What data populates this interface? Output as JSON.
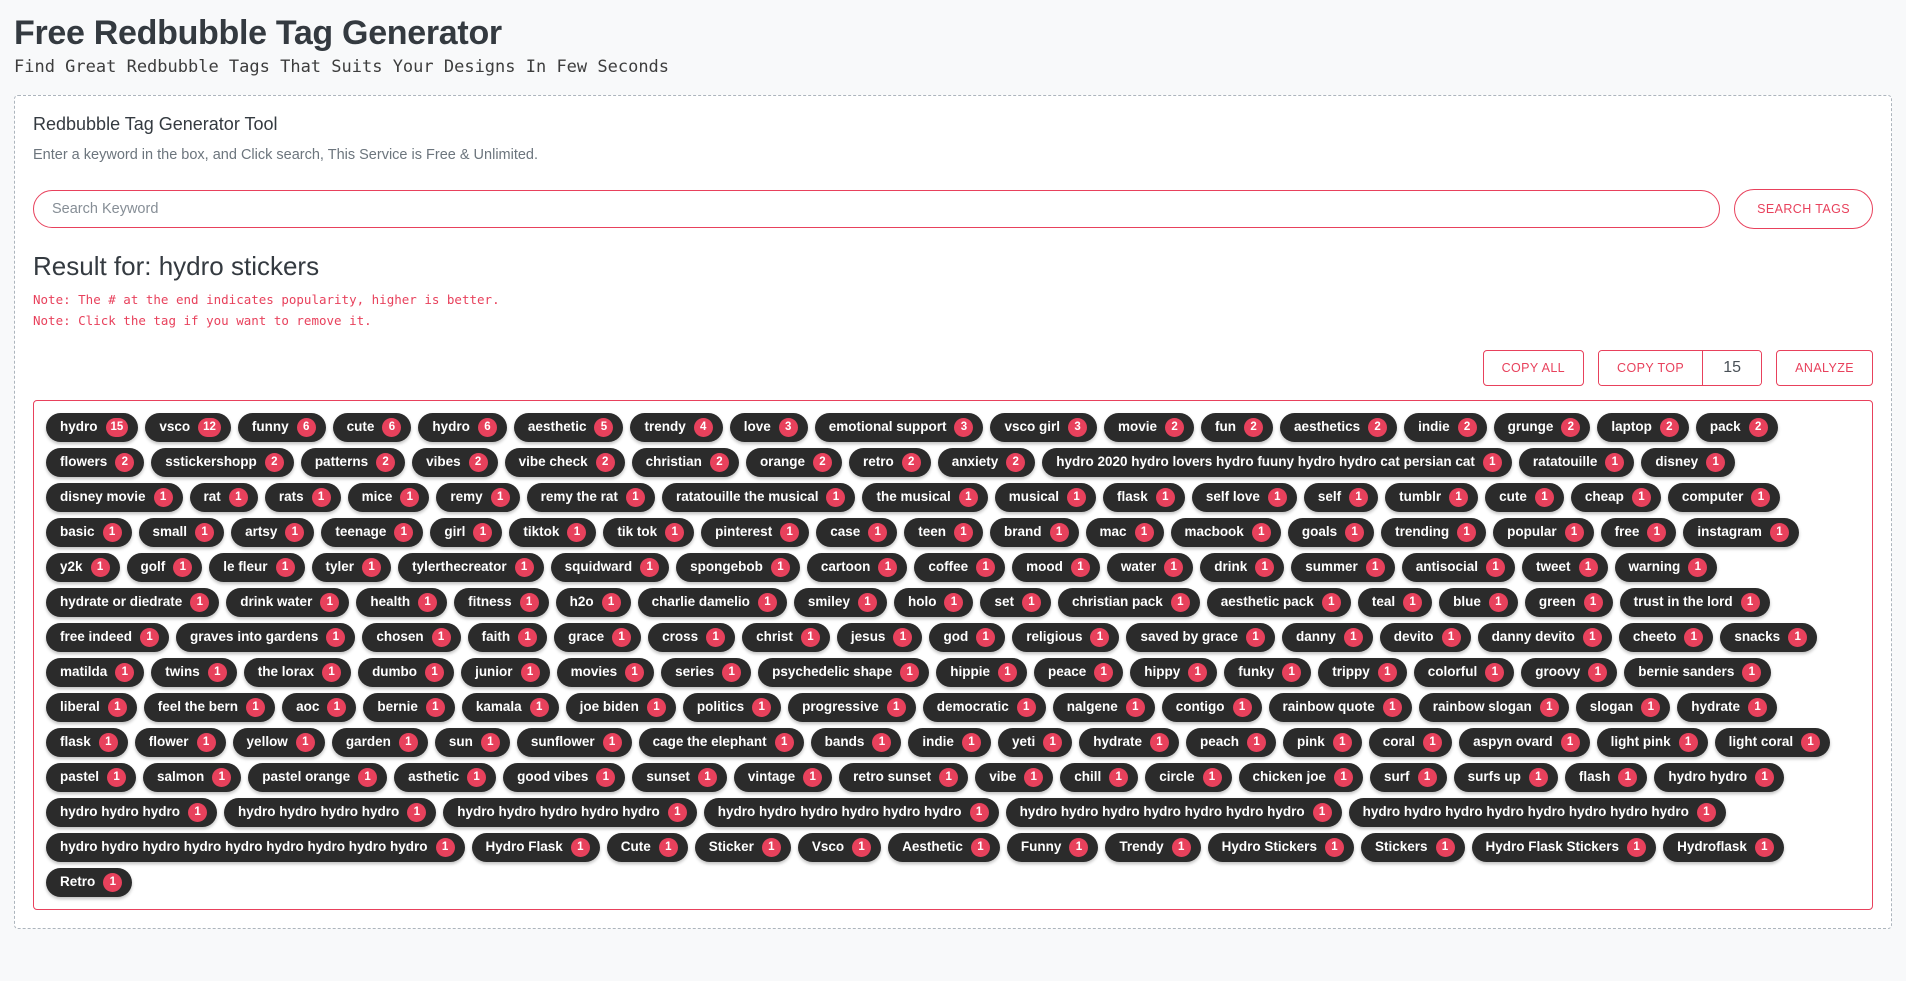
{
  "header": {
    "title": "Free Redbubble Tag Generator",
    "subtitle": "Find Great Redbubble Tags That Suits Your Designs In Few Seconds"
  },
  "tool": {
    "title": "Redbubble Tag Generator Tool",
    "description": "Enter a keyword in the box, and Click search, This Service is Free & Unlimited."
  },
  "search": {
    "value": "",
    "placeholder": "Search Keyword",
    "button_label": "SEARCH TAGS"
  },
  "result": {
    "title": "Result for: hydro stickers",
    "note_popularity": "Note: The # at the end indicates popularity, higher is better.",
    "note_remove": "Note: Click the tag if you want to remove it."
  },
  "actions": {
    "copy_all_label": "COPY ALL",
    "copy_top_label": "COPY TOP",
    "copy_top_value": "15",
    "analyze_label": "ANALYZE"
  },
  "colors": {
    "accent": "#e8415c",
    "tag_bg": "#2b2b2b",
    "page_bg": "#f8f9fa"
  },
  "tags": [
    {
      "label": "hydro",
      "count": "15"
    },
    {
      "label": "vsco",
      "count": "12"
    },
    {
      "label": "funny",
      "count": "6"
    },
    {
      "label": "cute",
      "count": "6"
    },
    {
      "label": "hydro",
      "count": "6"
    },
    {
      "label": "aesthetic",
      "count": "5"
    },
    {
      "label": "trendy",
      "count": "4"
    },
    {
      "label": "love",
      "count": "3"
    },
    {
      "label": "emotional support",
      "count": "3"
    },
    {
      "label": "vsco girl",
      "count": "3"
    },
    {
      "label": "movie",
      "count": "2"
    },
    {
      "label": "fun",
      "count": "2"
    },
    {
      "label": "aesthetics",
      "count": "2"
    },
    {
      "label": "indie",
      "count": "2"
    },
    {
      "label": "grunge",
      "count": "2"
    },
    {
      "label": "laptop",
      "count": "2"
    },
    {
      "label": "pack",
      "count": "2"
    },
    {
      "label": "flowers",
      "count": "2"
    },
    {
      "label": "sstickershopp",
      "count": "2"
    },
    {
      "label": "patterns",
      "count": "2"
    },
    {
      "label": "vibes",
      "count": "2"
    },
    {
      "label": "vibe check",
      "count": "2"
    },
    {
      "label": "christian",
      "count": "2"
    },
    {
      "label": "orange",
      "count": "2"
    },
    {
      "label": "retro",
      "count": "2"
    },
    {
      "label": "anxiety",
      "count": "2"
    },
    {
      "label": "hydro 2020 hydro lovers hydro fuuny hydro hydro cat persian cat",
      "count": "1"
    },
    {
      "label": "ratatouille",
      "count": "1"
    },
    {
      "label": "disney",
      "count": "1"
    },
    {
      "label": "disney movie",
      "count": "1"
    },
    {
      "label": "rat",
      "count": "1"
    },
    {
      "label": "rats",
      "count": "1"
    },
    {
      "label": "mice",
      "count": "1"
    },
    {
      "label": "remy",
      "count": "1"
    },
    {
      "label": "remy the rat",
      "count": "1"
    },
    {
      "label": "ratatouille the musical",
      "count": "1"
    },
    {
      "label": "the musical",
      "count": "1"
    },
    {
      "label": "musical",
      "count": "1"
    },
    {
      "label": "flask",
      "count": "1"
    },
    {
      "label": "self love",
      "count": "1"
    },
    {
      "label": "self",
      "count": "1"
    },
    {
      "label": "tumblr",
      "count": "1"
    },
    {
      "label": "cute",
      "count": "1"
    },
    {
      "label": "cheap",
      "count": "1"
    },
    {
      "label": "computer",
      "count": "1"
    },
    {
      "label": "basic",
      "count": "1"
    },
    {
      "label": "small",
      "count": "1"
    },
    {
      "label": "artsy",
      "count": "1"
    },
    {
      "label": "teenage",
      "count": "1"
    },
    {
      "label": "girl",
      "count": "1"
    },
    {
      "label": "tiktok",
      "count": "1"
    },
    {
      "label": "tik tok",
      "count": "1"
    },
    {
      "label": "pinterest",
      "count": "1"
    },
    {
      "label": "case",
      "count": "1"
    },
    {
      "label": "teen",
      "count": "1"
    },
    {
      "label": "brand",
      "count": "1"
    },
    {
      "label": "mac",
      "count": "1"
    },
    {
      "label": "macbook",
      "count": "1"
    },
    {
      "label": "goals",
      "count": "1"
    },
    {
      "label": "trending",
      "count": "1"
    },
    {
      "label": "popular",
      "count": "1"
    },
    {
      "label": "free",
      "count": "1"
    },
    {
      "label": "instagram",
      "count": "1"
    },
    {
      "label": "y2k",
      "count": "1"
    },
    {
      "label": "golf",
      "count": "1"
    },
    {
      "label": "le fleur",
      "count": "1"
    },
    {
      "label": "tyler",
      "count": "1"
    },
    {
      "label": "tylerthecreator",
      "count": "1"
    },
    {
      "label": "squidward",
      "count": "1"
    },
    {
      "label": "spongebob",
      "count": "1"
    },
    {
      "label": "cartoon",
      "count": "1"
    },
    {
      "label": "coffee",
      "count": "1"
    },
    {
      "label": "mood",
      "count": "1"
    },
    {
      "label": "water",
      "count": "1"
    },
    {
      "label": "drink",
      "count": "1"
    },
    {
      "label": "summer",
      "count": "1"
    },
    {
      "label": "antisocial",
      "count": "1"
    },
    {
      "label": "tweet",
      "count": "1"
    },
    {
      "label": "warning",
      "count": "1"
    },
    {
      "label": "hydrate or diedrate",
      "count": "1"
    },
    {
      "label": "drink water",
      "count": "1"
    },
    {
      "label": "health",
      "count": "1"
    },
    {
      "label": "fitness",
      "count": "1"
    },
    {
      "label": "h2o",
      "count": "1"
    },
    {
      "label": "charlie damelio",
      "count": "1"
    },
    {
      "label": "smiley",
      "count": "1"
    },
    {
      "label": "holo",
      "count": "1"
    },
    {
      "label": "set",
      "count": "1"
    },
    {
      "label": "christian pack",
      "count": "1"
    },
    {
      "label": "aesthetic pack",
      "count": "1"
    },
    {
      "label": "teal",
      "count": "1"
    },
    {
      "label": "blue",
      "count": "1"
    },
    {
      "label": "green",
      "count": "1"
    },
    {
      "label": "trust in the lord",
      "count": "1"
    },
    {
      "label": "free indeed",
      "count": "1"
    },
    {
      "label": "graves into gardens",
      "count": "1"
    },
    {
      "label": "chosen",
      "count": "1"
    },
    {
      "label": "faith",
      "count": "1"
    },
    {
      "label": "grace",
      "count": "1"
    },
    {
      "label": "cross",
      "count": "1"
    },
    {
      "label": "christ",
      "count": "1"
    },
    {
      "label": "jesus",
      "count": "1"
    },
    {
      "label": "god",
      "count": "1"
    },
    {
      "label": "religious",
      "count": "1"
    },
    {
      "label": "saved by grace",
      "count": "1"
    },
    {
      "label": "danny",
      "count": "1"
    },
    {
      "label": "devito",
      "count": "1"
    },
    {
      "label": "danny devito",
      "count": "1"
    },
    {
      "label": "cheeto",
      "count": "1"
    },
    {
      "label": "snacks",
      "count": "1"
    },
    {
      "label": "matilda",
      "count": "1"
    },
    {
      "label": "twins",
      "count": "1"
    },
    {
      "label": "the lorax",
      "count": "1"
    },
    {
      "label": "dumbo",
      "count": "1"
    },
    {
      "label": "junior",
      "count": "1"
    },
    {
      "label": "movies",
      "count": "1"
    },
    {
      "label": "series",
      "count": "1"
    },
    {
      "label": "psychedelic shape",
      "count": "1"
    },
    {
      "label": "hippie",
      "count": "1"
    },
    {
      "label": "peace",
      "count": "1"
    },
    {
      "label": "hippy",
      "count": "1"
    },
    {
      "label": "funky",
      "count": "1"
    },
    {
      "label": "trippy",
      "count": "1"
    },
    {
      "label": "colorful",
      "count": "1"
    },
    {
      "label": "groovy",
      "count": "1"
    },
    {
      "label": "bernie sanders",
      "count": "1"
    },
    {
      "label": "liberal",
      "count": "1"
    },
    {
      "label": "feel the bern",
      "count": "1"
    },
    {
      "label": "aoc",
      "count": "1"
    },
    {
      "label": "bernie",
      "count": "1"
    },
    {
      "label": "kamala",
      "count": "1"
    },
    {
      "label": "joe biden",
      "count": "1"
    },
    {
      "label": "politics",
      "count": "1"
    },
    {
      "label": "progressive",
      "count": "1"
    },
    {
      "label": "democratic",
      "count": "1"
    },
    {
      "label": "nalgene",
      "count": "1"
    },
    {
      "label": "contigo",
      "count": "1"
    },
    {
      "label": "rainbow quote",
      "count": "1"
    },
    {
      "label": "rainbow slogan",
      "count": "1"
    },
    {
      "label": "slogan",
      "count": "1"
    },
    {
      "label": "hydrate",
      "count": "1"
    },
    {
      "label": "flask",
      "count": "1"
    },
    {
      "label": "flower",
      "count": "1"
    },
    {
      "label": "yellow",
      "count": "1"
    },
    {
      "label": "garden",
      "count": "1"
    },
    {
      "label": "sun",
      "count": "1"
    },
    {
      "label": "sunflower",
      "count": "1"
    },
    {
      "label": "cage the elephant",
      "count": "1"
    },
    {
      "label": "bands",
      "count": "1"
    },
    {
      "label": "indie",
      "count": "1"
    },
    {
      "label": "yeti",
      "count": "1"
    },
    {
      "label": "hydrate",
      "count": "1"
    },
    {
      "label": "peach",
      "count": "1"
    },
    {
      "label": "pink",
      "count": "1"
    },
    {
      "label": "coral",
      "count": "1"
    },
    {
      "label": "aspyn ovard",
      "count": "1"
    },
    {
      "label": "light pink",
      "count": "1"
    },
    {
      "label": "light coral",
      "count": "1"
    },
    {
      "label": "pastel",
      "count": "1"
    },
    {
      "label": "salmon",
      "count": "1"
    },
    {
      "label": "pastel orange",
      "count": "1"
    },
    {
      "label": "asthetic",
      "count": "1"
    },
    {
      "label": "good vibes",
      "count": "1"
    },
    {
      "label": "sunset",
      "count": "1"
    },
    {
      "label": "vintage",
      "count": "1"
    },
    {
      "label": "retro sunset",
      "count": "1"
    },
    {
      "label": "vibe",
      "count": "1"
    },
    {
      "label": "chill",
      "count": "1"
    },
    {
      "label": "circle",
      "count": "1"
    },
    {
      "label": "chicken joe",
      "count": "1"
    },
    {
      "label": "surf",
      "count": "1"
    },
    {
      "label": "surfs up",
      "count": "1"
    },
    {
      "label": "flash",
      "count": "1"
    },
    {
      "label": "hydro hydro",
      "count": "1"
    },
    {
      "label": "hydro hydro hydro",
      "count": "1"
    },
    {
      "label": "hydro hydro hydro hydro",
      "count": "1"
    },
    {
      "label": "hydro hydro hydro hydro hydro",
      "count": "1"
    },
    {
      "label": "hydro hydro hydro hydro hydro hydro",
      "count": "1"
    },
    {
      "label": "hydro hydro hydro hydro hydro hydro hydro",
      "count": "1"
    },
    {
      "label": "hydro hydro hydro hydro hydro hydro hydro hydro",
      "count": "1"
    },
    {
      "label": "hydro hydro hydro hydro hydro hydro hydro hydro hydro",
      "count": "1"
    },
    {
      "label": "Hydro Flask",
      "count": "1"
    },
    {
      "label": "Cute",
      "count": "1"
    },
    {
      "label": "Sticker",
      "count": "1"
    },
    {
      "label": "Vsco",
      "count": "1"
    },
    {
      "label": "Aesthetic",
      "count": "1"
    },
    {
      "label": "Funny",
      "count": "1"
    },
    {
      "label": "Trendy",
      "count": "1"
    },
    {
      "label": "Hydro Stickers",
      "count": "1"
    },
    {
      "label": "Stickers",
      "count": "1"
    },
    {
      "label": "Hydro Flask Stickers",
      "count": "1"
    },
    {
      "label": "Hydroflask",
      "count": "1"
    },
    {
      "label": "Retro",
      "count": "1"
    }
  ]
}
